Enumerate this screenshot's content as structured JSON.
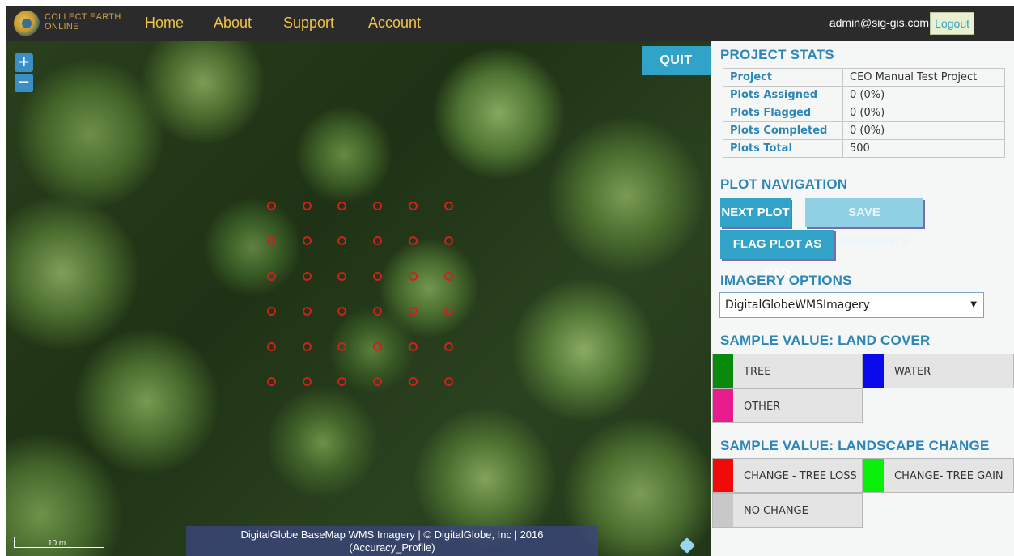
{
  "nav": {
    "brand_line1": "COLLECT EARTH",
    "brand_line2": "ONLINE",
    "links": [
      "Home",
      "About",
      "Support",
      "Account"
    ],
    "user_email": "admin@sig-gis.com",
    "logout_label": "Logout"
  },
  "map": {
    "zoom_in_label": "+",
    "zoom_out_label": "−",
    "quit_label": "QUIT",
    "scale_label": "10 m",
    "attribution_line1": "DigitalGlobe BaseMap WMS Imagery | © DigitalGlobe, Inc | 2016",
    "attribution_line2": "(Accuracy_Profile)",
    "sample_point_color": "#d0201e"
  },
  "stats": {
    "title": "PROJECT STATS",
    "rows": [
      {
        "label": "Project",
        "value": "CEO Manual Test Project"
      },
      {
        "label": "Plots Assigned",
        "value": "0 (0%)"
      },
      {
        "label": "Plots Flagged",
        "value": "0 (0%)"
      },
      {
        "label": "Plots Completed",
        "value": "0 (0%)"
      },
      {
        "label": "Plots Total",
        "value": "500"
      }
    ]
  },
  "navigation": {
    "title": "PLOT NAVIGATION",
    "next_label": "NEXT PLOT",
    "save_label": "SAVE ASSIGNMENTS",
    "flag_label": "FLAG PLOT AS BAD"
  },
  "imagery": {
    "title": "IMAGERY OPTIONS",
    "selected": "DigitalGlobeWMSImagery"
  },
  "land_cover": {
    "title": "SAMPLE VALUE: LAND COVER",
    "options": [
      {
        "label": "TREE",
        "color": "#0a8a0a"
      },
      {
        "label": "WATER",
        "color": "#0a0aea"
      },
      {
        "label": "OTHER",
        "color": "#e81c8c"
      }
    ]
  },
  "landscape_change": {
    "title": "SAMPLE VALUE: LANDSCAPE CHANGE",
    "options": [
      {
        "label": "CHANGE - TREE LOSS",
        "color": "#f00a0a"
      },
      {
        "label": "CHANGE- TREE GAIN",
        "color": "#0af00a"
      },
      {
        "label": "NO CHANGE",
        "color": "#c8c8c8"
      }
    ]
  },
  "colors": {
    "accent": "#31a3c9",
    "nav_bg": "#2b2b2b",
    "nav_link": "#f0c24a",
    "heading": "#2d86b8"
  }
}
